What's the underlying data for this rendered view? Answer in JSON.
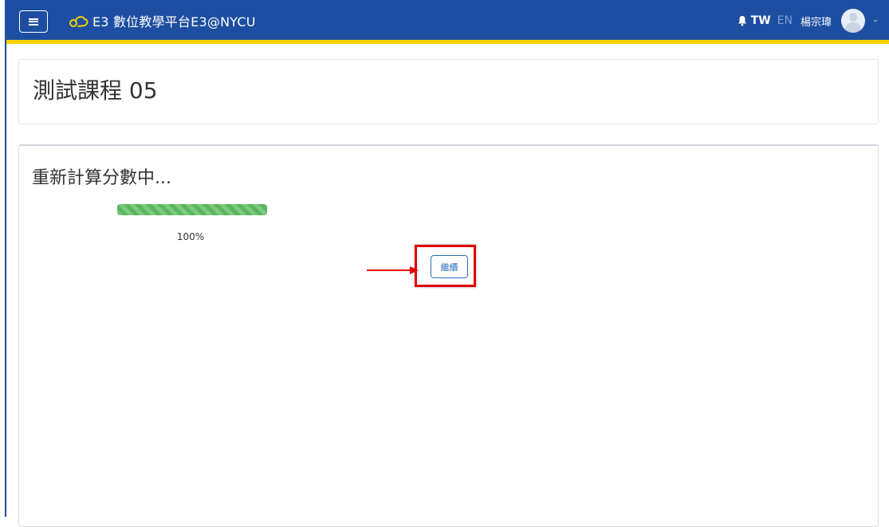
{
  "navbar": {
    "brand": "E3 數位教學平台E3@NYCU",
    "lang_tw": "TW",
    "lang_en": "EN",
    "user_name": "楊宗瑋"
  },
  "page": {
    "course_title": "測試課程 05"
  },
  "main": {
    "heading": "重新計算分數中...",
    "progress_percent": 100,
    "progress_label": "100%",
    "continue_label": "繼續"
  },
  "colors": {
    "navbar": "#1e4ea1",
    "navbar_accent": "#f5d300",
    "progress": "#58b75c",
    "button": "#2c6fbd",
    "annotation": "#e00000"
  },
  "icons": [
    "menu-icon",
    "e3-logo-icon",
    "bell-icon",
    "avatar-icon",
    "caret-down-icon",
    "arrow-icon"
  ]
}
